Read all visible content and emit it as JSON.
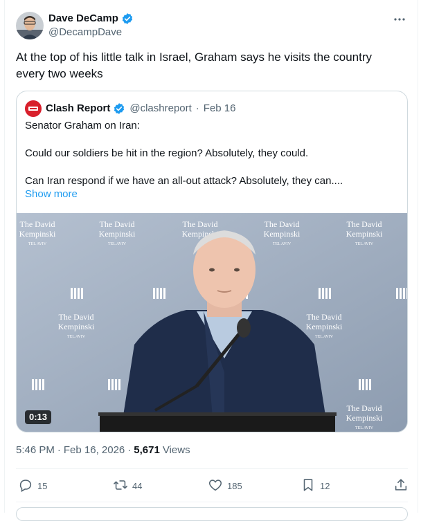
{
  "author": {
    "display_name": "Dave DeCamp",
    "handle": "@DecampDave",
    "verified": true
  },
  "tweet": {
    "text": "At the top of his little talk in Israel, Graham says he visits the country every two weeks"
  },
  "quote": {
    "display_name": "Clash Report",
    "handle": "@clashreport",
    "separator": "·",
    "date": "Feb 16",
    "paragraphs": [
      "Senator Graham on Iran:",
      "Could our soldiers be hit in the region? Absolutely, they could.",
      "Can Iran respond if we have an all-out attack? Absolutely, they can...."
    ],
    "show_more": "Show more",
    "video": {
      "duration": "0:13",
      "backdrop_text": [
        "The David",
        "Kempinski",
        "TEL AVIV"
      ]
    }
  },
  "meta": {
    "time": "5:46 PM",
    "dot1": "·",
    "date": "Feb 16, 2026",
    "dot2": "·",
    "views_count": "5,671",
    "views_label": "Views"
  },
  "actions": {
    "replies": "15",
    "reposts": "44",
    "likes": "185",
    "bookmarks": "12"
  },
  "colors": {
    "accent": "#1d9bf0",
    "muted": "#536471",
    "border": "#cfd9de"
  }
}
